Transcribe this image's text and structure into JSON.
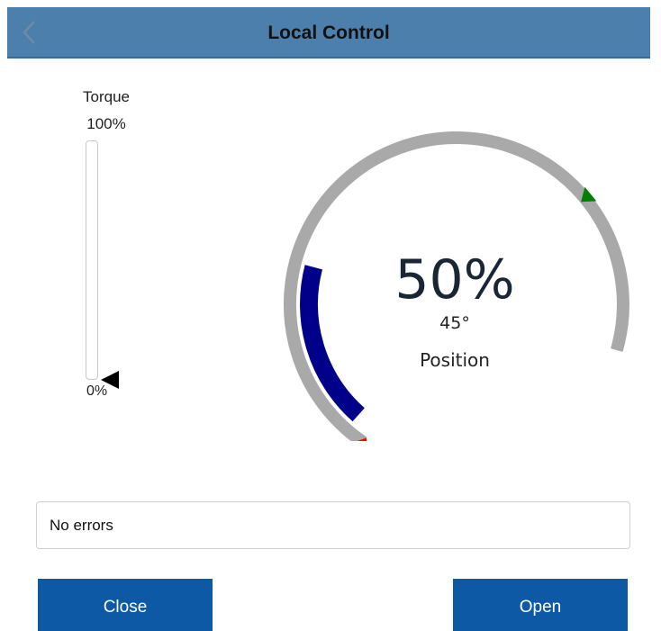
{
  "header": {
    "title": "Local Control",
    "back_icon": "chevron-left-icon"
  },
  "torque": {
    "label": "Torque",
    "max_label": "100%",
    "min_label": "0%",
    "level_fraction": 0.0
  },
  "gauge": {
    "value_text": "50%",
    "angle_text": "45°",
    "label": "Position",
    "position_fraction": 0.5,
    "colors": {
      "track": "#a9a9a9",
      "fill": "#00008b",
      "start_marker": "#ff0000",
      "end_marker": "#008000"
    }
  },
  "status": {
    "text": "No errors"
  },
  "buttons": {
    "close_label": "Close",
    "open_label": "Open"
  },
  "colors": {
    "header_bg": "#4d7fad",
    "button_bg": "#0d59a6"
  }
}
